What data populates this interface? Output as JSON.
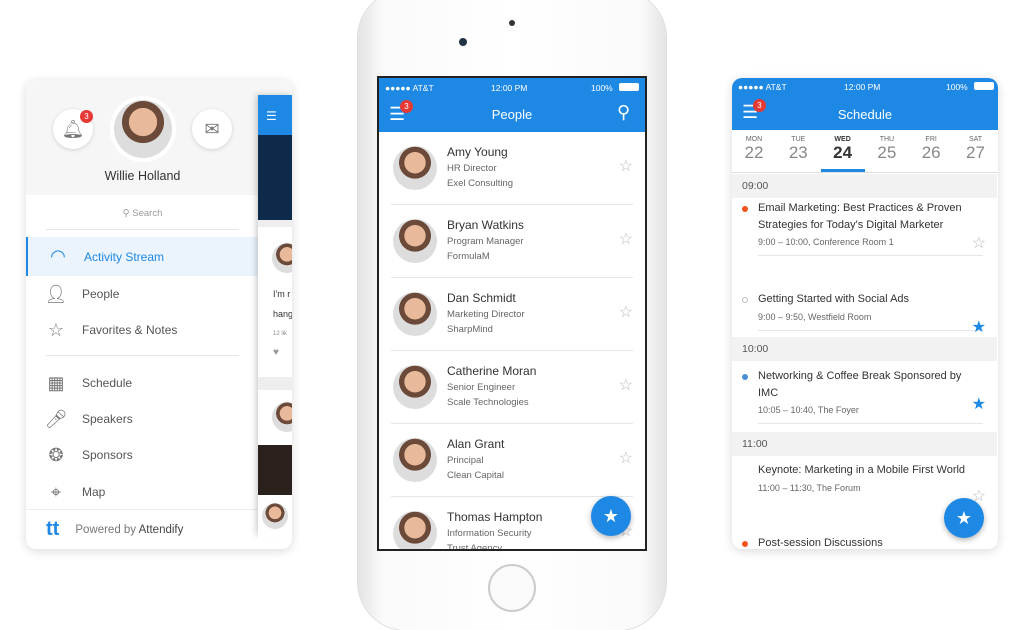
{
  "accent": "#1e88e5",
  "menu": {
    "user_name": "Willie Holland",
    "notification_count": "3",
    "search_placeholder": "Search",
    "items": [
      {
        "label": "Activity Stream",
        "icon": "wifi-icon",
        "active": true
      },
      {
        "label": "People",
        "icon": "people-icon"
      },
      {
        "label": "Favorites & Notes",
        "icon": "star-icon"
      },
      {
        "label": "Schedule",
        "icon": "calendar-icon"
      },
      {
        "label": "Speakers",
        "icon": "microphone-icon"
      },
      {
        "label": "Sponsors",
        "icon": "award-icon"
      },
      {
        "label": "Map",
        "icon": "map-pin-icon"
      }
    ],
    "footer_prefix": "Powered by ",
    "footer_brand": "Attendify",
    "peek": {
      "line1": "I'm r",
      "line2": "hang",
      "likes": "12 lik"
    }
  },
  "people": {
    "status": {
      "carrier": "●●●●● AT&T",
      "time": "12:00 PM",
      "battery": "100%"
    },
    "title": "People",
    "badge": "3",
    "list": [
      {
        "name": "Amy Young",
        "role": "HR Director",
        "company": "Exel Consulting"
      },
      {
        "name": "Bryan Watkins",
        "role": "Program Manager",
        "company": "FormulaM"
      },
      {
        "name": "Dan Schmidt",
        "role": "Marketing Director",
        "company": "SharpMind"
      },
      {
        "name": "Catherine Moran",
        "role": "Senior Engineer",
        "company": "Scale Technologies"
      },
      {
        "name": "Alan Grant",
        "role": "Principal",
        "company": "Clean Capital"
      },
      {
        "name": "Thomas Hampton",
        "role": "Information Security",
        "company": "Trust Agency"
      }
    ]
  },
  "schedule": {
    "status": {
      "carrier": "●●●●● AT&T",
      "time": "12:00 PM",
      "battery": "100%"
    },
    "title": "Schedule",
    "badge": "3",
    "days": [
      {
        "dow": "MON",
        "num": "22"
      },
      {
        "dow": "TUE",
        "num": "23"
      },
      {
        "dow": "WED",
        "num": "24",
        "selected": true
      },
      {
        "dow": "THU",
        "num": "25"
      },
      {
        "dow": "FRI",
        "num": "26"
      },
      {
        "dow": "SAT",
        "num": "27"
      }
    ],
    "hours": [
      "09:00",
      "10:00",
      "11:00"
    ],
    "sessions": [
      {
        "title": "Email Marketing: Best Practices & Proven Strategies for Today's Digital Marketer",
        "meta": "9:00 – 10:00,  Conference Room 1",
        "favorite": false,
        "dot": "#f4511e"
      },
      {
        "title": "Getting Started with Social Ads",
        "meta": "9:00 – 9:50,  Westfield Room",
        "favorite": true,
        "dot": "none"
      },
      {
        "title": "Networking & Coffee Break Sponsored by IMC",
        "meta": "10:05 – 10:40,  The Foyer",
        "favorite": true,
        "dot": "#4a90d9"
      },
      {
        "title": "Keynote: Marketing in a Mobile First World",
        "meta": "11:00 – 11:30,  The Forum",
        "favorite": false,
        "dot": ""
      },
      {
        "title": "Post-session Discussions",
        "meta": "",
        "favorite": false,
        "dot": "#f4511e"
      }
    ]
  }
}
